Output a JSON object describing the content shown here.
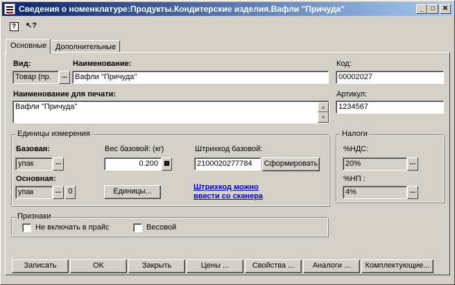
{
  "window": {
    "title": "Сведения о номенклатуре:Продукты.Кондитерские изделия.Вафли \"Причуда\"",
    "minimize": "_",
    "maximize": "□",
    "close": "✕"
  },
  "toolbar": {
    "help": "?",
    "whats_this": "↖?"
  },
  "tabs": [
    {
      "label": "Основные",
      "active": true
    },
    {
      "label": "Дополнительные",
      "active": false
    }
  ],
  "form": {
    "vid_label": "Вид:",
    "vid_value": "Товар (пр.",
    "name_label": "Наименование:",
    "name_value": "Вафли \"Причуда\"",
    "code_label": "Код:",
    "code_value": "00002027",
    "print_name_label": "Наименование для печати:",
    "print_name_value": "Вафли \"Причуда\"",
    "article_label": "Артикул:",
    "article_value": "1234567",
    "select_glyph": "..."
  },
  "units": {
    "group_title": "Единицы измерения",
    "base_label": "Базовая:",
    "base_value": "упак",
    "weight_label": "Вес базовой: (кг)",
    "weight_value": "0.200",
    "barcode_label": "Штрихкод базовой:",
    "barcode_value": "2100020277784",
    "generate_button": "Сформировать",
    "main_label": "Основная:",
    "main_value": "упак",
    "zero_button": "0",
    "units_button": "Единицы...",
    "scanner_link_line1": "Штрихкод можно",
    "scanner_link_line2": "ввести со сканера"
  },
  "taxes": {
    "group_title": "Налоги",
    "vat_label": "%НДС:",
    "vat_value": "20%",
    "np_label": "%НП :",
    "np_value": "4%"
  },
  "attributes": {
    "group_title": "Признаки",
    "exclude_pricelist": "Не включать в прайс",
    "weighted": "Весовой"
  },
  "buttons": {
    "save": "Записать",
    "ok": "OK",
    "close": "Закрыть",
    "prices": "Цены ...",
    "properties": "Свойства ...",
    "analogs": "Аналоги ...",
    "components": "Комплектующие..."
  }
}
